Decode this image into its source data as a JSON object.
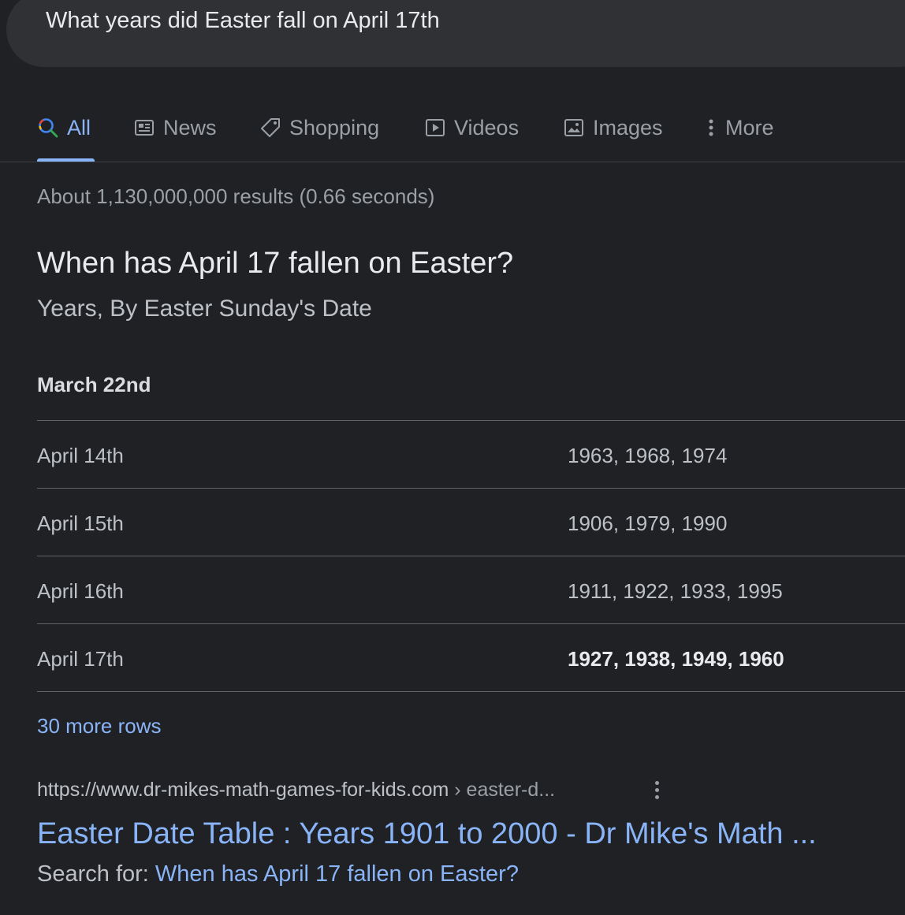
{
  "search": {
    "query": "What years did Easter fall on April 17th"
  },
  "tabs": [
    {
      "label": "All",
      "icon": "search-icon",
      "active": true
    },
    {
      "label": "News",
      "icon": "news-icon"
    },
    {
      "label": "Shopping",
      "icon": "tag-icon"
    },
    {
      "label": "Videos",
      "icon": "play-icon"
    },
    {
      "label": "Images",
      "icon": "image-icon"
    },
    {
      "label": "More",
      "icon": "more-vert-icon"
    }
  ],
  "result_stats": "About 1,130,000,000 results (0.66 seconds)",
  "snippet": {
    "question": "When has April 17 fallen on Easter?",
    "subtitle": "Years, By Easter Sunday's Date",
    "table_header": "March 22nd",
    "rows": [
      {
        "date": "April 14th",
        "years": "1963, 1968, 1974"
      },
      {
        "date": "April 15th",
        "years": "1906, 1979, 1990"
      },
      {
        "date": "April 16th",
        "years": "1911, 1922, 1933, 1995"
      },
      {
        "date": "April 17th",
        "years": "1927, 1938, 1949, 1960",
        "highlight": true
      }
    ],
    "more_rows": "30 more rows"
  },
  "source": {
    "url": "https://www.dr-mikes-math-games-for-kids.com",
    "breadcrumb": " › easter-d...",
    "title": "Easter Date Table : Years 1901 to 2000 - Dr Mike's Math ...",
    "search_for_label": "Search for: ",
    "search_for_link": "When has April 17 fallen on Easter?"
  },
  "colors": {
    "background": "#202124",
    "link": "#8ab4f8",
    "search_bar": "#303134"
  }
}
